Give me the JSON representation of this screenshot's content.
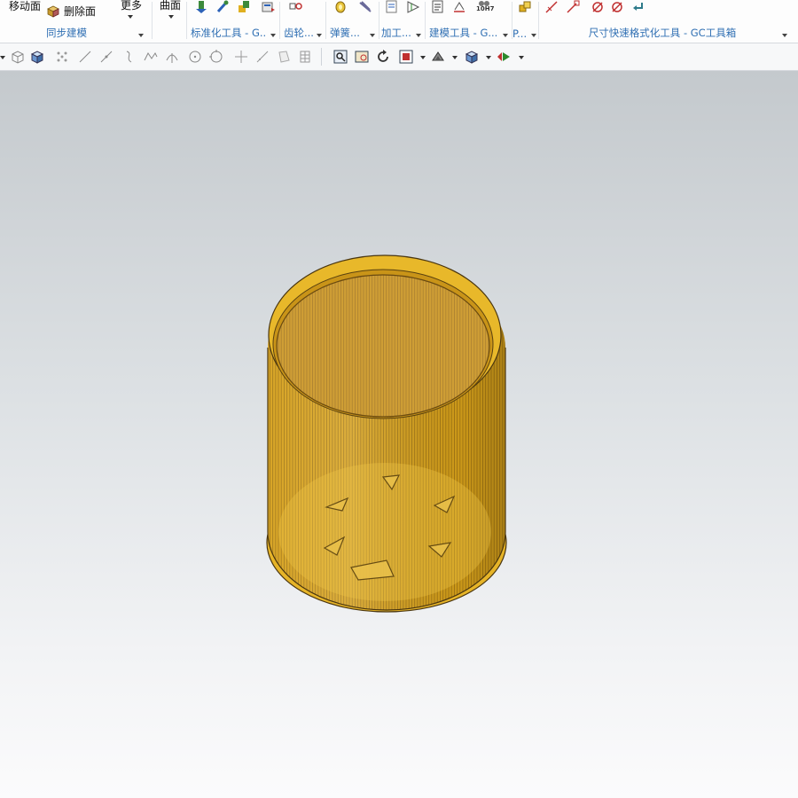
{
  "ribbon": {
    "sync_group": {
      "move_face": "移动面",
      "delete_face": "删除面",
      "more": "更多",
      "label": "同步建模"
    },
    "surface_group": {
      "surface": "曲面"
    },
    "groups": [
      {
        "id": "standard",
        "label": "标准化工具 - G..."
      },
      {
        "id": "gear",
        "label": "齿轮..."
      },
      {
        "id": "spring",
        "label": "弹簧..."
      },
      {
        "id": "machining",
        "label": "加工..."
      },
      {
        "id": "modeling",
        "label": "建模工具 - G..."
      },
      {
        "id": "p",
        "label": "P..."
      },
      {
        "id": "dimension",
        "label": "尺寸快速格式化工具 - GC工具箱"
      }
    ],
    "fit_tolerance": "10H7"
  },
  "colors": {
    "accent_text": "#2f6fb3",
    "model_fill": "#d8a419",
    "model_edge": "#5a4210",
    "viewport_top": "#c4c9cd",
    "viewport_bottom": "#fbfbfc"
  }
}
